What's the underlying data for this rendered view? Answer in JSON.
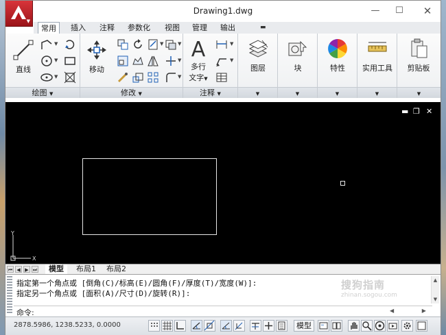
{
  "window": {
    "title": "Drawing1.dwg"
  },
  "ribbon_tabs": [
    "常用",
    "插入",
    "注释",
    "参数化",
    "视图",
    "管理",
    "输出"
  ],
  "panels": {
    "draw": {
      "title": "绘图",
      "line": "直线"
    },
    "modify": {
      "title": "修改",
      "move": "移动"
    },
    "annotation": {
      "title": "注释",
      "mtext_line1": "多行",
      "mtext_line2": "文字"
    },
    "layers": {
      "label": "图层"
    },
    "block": {
      "label": "块"
    },
    "properties": {
      "label": "特性"
    },
    "utilities": {
      "label": "实用工具"
    },
    "clipboard": {
      "label": "剪贴板"
    }
  },
  "layout_tabs": [
    "模型",
    "布局1",
    "布局2"
  ],
  "command": {
    "history": [
      "指定第一个角点或 [倒角(C)/标高(E)/圆角(F)/厚度(T)/宽度(W)]:",
      "指定另一个角点或 [面积(A)/尺寸(D)/旋转(R)]:"
    ],
    "prompt": "命令:"
  },
  "ucs": {
    "x": "X",
    "y": "Y"
  },
  "watermark": {
    "text": "搜狗指南",
    "url": "zhinan.sogou.com"
  },
  "status": {
    "coords": "2878.5986, 1238.5233, 0.0000",
    "model_label": "模型"
  },
  "colors": {
    "canvas": "#000000",
    "accent": "#c41e24"
  }
}
